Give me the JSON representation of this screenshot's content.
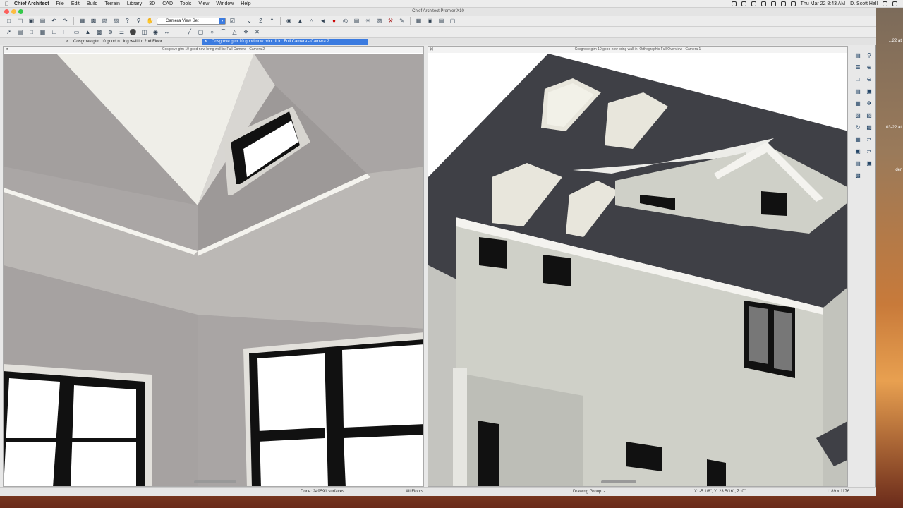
{
  "menubar": {
    "app": "Chief Architect",
    "items": [
      "File",
      "Edit",
      "Build",
      "Terrain",
      "Library",
      "3D",
      "CAD",
      "Tools",
      "View",
      "Window",
      "Help"
    ],
    "clock": "Thu Mar 22  8:43 AM",
    "user": "D. Scott Hall"
  },
  "window": {
    "title": "Chief Architect Premier X10"
  },
  "toolbar": {
    "view_set": "Camera View Set",
    "count": "2"
  },
  "tabs": [
    {
      "label": "Cosgrove gtm 10 good n...ing wall in: 2nd Floor",
      "active": false
    },
    {
      "label": "Cosgrove gtm 10 good now brin...ll in: Full Camera - Camera 2",
      "active": true
    }
  ],
  "pane1": {
    "header": "Cosgrove gtm 10 good now bring wall in: Full Camera - Camera 2"
  },
  "pane2": {
    "header": "Cosgrove gtm 10 good now bring wall in: Orthographic Full Overview - Camera 1"
  },
  "status": {
    "done": "Done:  249591 surfaces",
    "floors": "All Floors",
    "group": "Drawing Group: -",
    "coords": "X: -5 1/8\", Y: 23 5/16\", Z: 0\"",
    "size": "1189 x 1176"
  },
  "desktop": {
    "label1": "...22 at",
    "label2": "03-22 at",
    "label3": "der"
  }
}
